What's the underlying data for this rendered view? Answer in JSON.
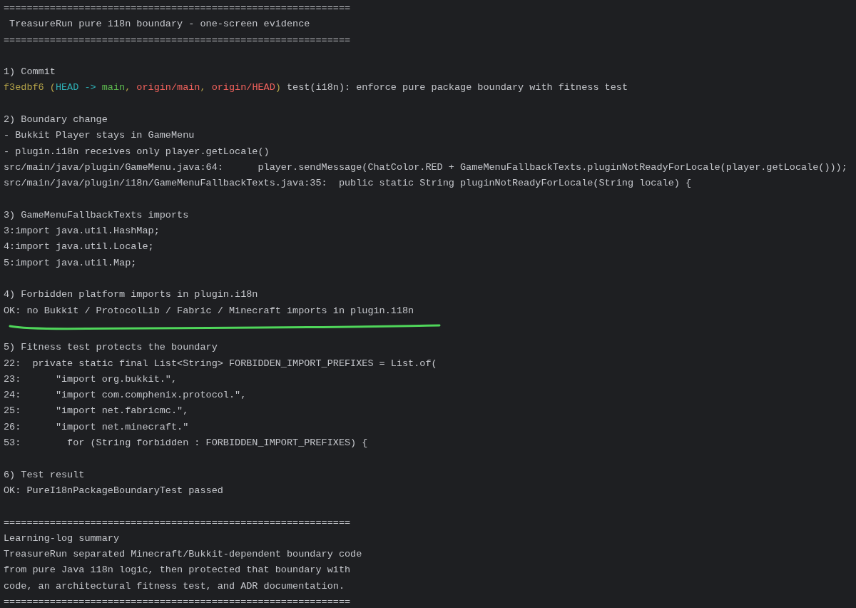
{
  "banner": {
    "rule_top": "============================================================",
    "title": " TreasureRun pure i18n boundary - one-screen evidence",
    "rule_bottom": "============================================================"
  },
  "sections": [
    {
      "heading": "1) Commit",
      "commit": {
        "segments": [
          {
            "text": "f3edbf6 (",
            "kind": "hash"
          },
          {
            "text": "HEAD -> ",
            "kind": "head"
          },
          {
            "text": "main",
            "kind": "local"
          },
          {
            "text": ", ",
            "kind": "hash"
          },
          {
            "text": "origin/main",
            "kind": "remote"
          },
          {
            "text": ", ",
            "kind": "hash"
          },
          {
            "text": "origin/HEAD",
            "kind": "remote"
          },
          {
            "text": ")",
            "kind": "hash"
          },
          {
            "text": " test(i18n): enforce pure package boundary with fitness test",
            "kind": "message"
          }
        ]
      }
    },
    {
      "heading": "2) Boundary change",
      "lines": [
        "- Bukkit Player stays in GameMenu",
        "- plugin.i18n receives only player.getLocale()",
        "src/main/java/plugin/GameMenu.java:64:      player.sendMessage(ChatColor.RED + GameMenuFallbackTexts.pluginNotReadyForLocale(player.getLocale()));",
        "src/main/java/plugin/i18n/GameMenuFallbackTexts.java:35:  public static String pluginNotReadyForLocale(String locale) {"
      ]
    },
    {
      "heading": "3) GameMenuFallbackTexts imports",
      "lines": [
        "3:import java.util.HashMap;",
        "4:import java.util.Locale;",
        "5:import java.util.Map;"
      ]
    },
    {
      "heading": "4) Forbidden platform imports in plugin.i18n",
      "lines": [
        "OK: no Bukkit / ProtocolLib / Fabric / Minecraft imports in plugin.i18n"
      ],
      "underlined": true
    },
    {
      "heading": "5) Fitness test protects the boundary",
      "lines": [
        "22:  private static final List<String> FORBIDDEN_IMPORT_PREFIXES = List.of(",
        "23:      \"import org.bukkit.\",",
        "24:      \"import com.comphenix.protocol.\",",
        "25:      \"import net.fabricmc.\",",
        "26:      \"import net.minecraft.\"",
        "53:        for (String forbidden : FORBIDDEN_IMPORT_PREFIXES) {"
      ]
    },
    {
      "heading": "6) Test result",
      "lines": [
        "OK: PureI18nPackageBoundaryTest passed"
      ]
    }
  ],
  "summary": {
    "rule_top": "============================================================",
    "heading": "Learning-log summary",
    "lines": [
      "TreasureRun separated Minecraft/Bukkit-dependent boundary code",
      "from pure Java i18n logic, then protected that boundary with",
      "code, an architectural fitness test, and ADR documentation."
    ],
    "rule_bottom": "============================================================"
  }
}
